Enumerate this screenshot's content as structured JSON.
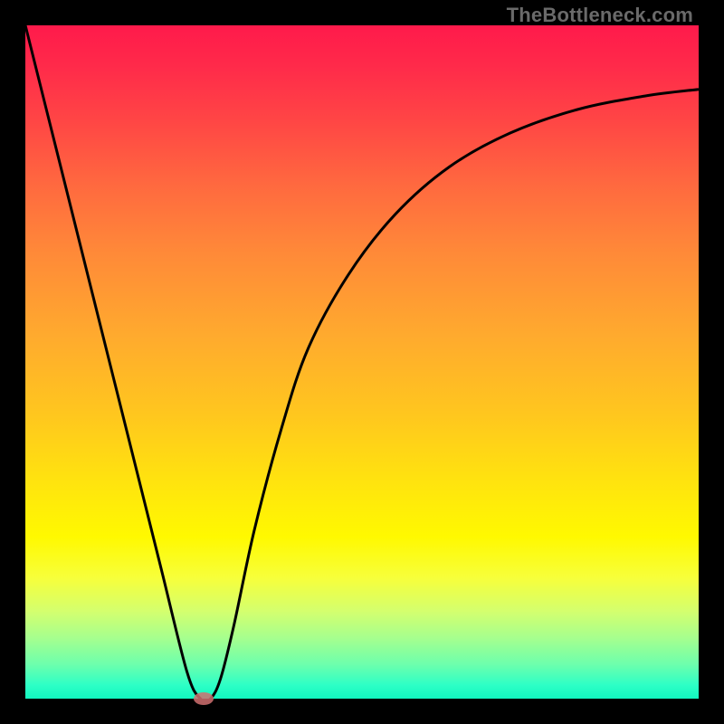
{
  "watermark": "TheBottleneck.com",
  "colors": {
    "background": "#000000",
    "curve_stroke": "#000000",
    "dot_fill": "#d07070"
  },
  "chart_data": {
    "type": "line",
    "title": "",
    "xlabel": "",
    "ylabel": "",
    "xlim": [
      0,
      100
    ],
    "ylim": [
      0,
      100
    ],
    "grid": false,
    "legend": false,
    "series": [
      {
        "name": "bottleneck-curve",
        "x": [
          0,
          5,
          10,
          15,
          20,
          24,
          26,
          27.5,
          29,
          31,
          34,
          38,
          42,
          48,
          55,
          63,
          72,
          82,
          92,
          100
        ],
        "values": [
          100,
          80,
          60,
          40,
          20,
          4,
          0,
          0,
          3,
          11,
          25,
          40,
          52,
          63,
          72,
          79,
          84,
          87.5,
          89.5,
          90.5
        ]
      }
    ],
    "annotations": [
      {
        "name": "minimum-dot",
        "x": 26.5,
        "y": 0
      }
    ]
  }
}
